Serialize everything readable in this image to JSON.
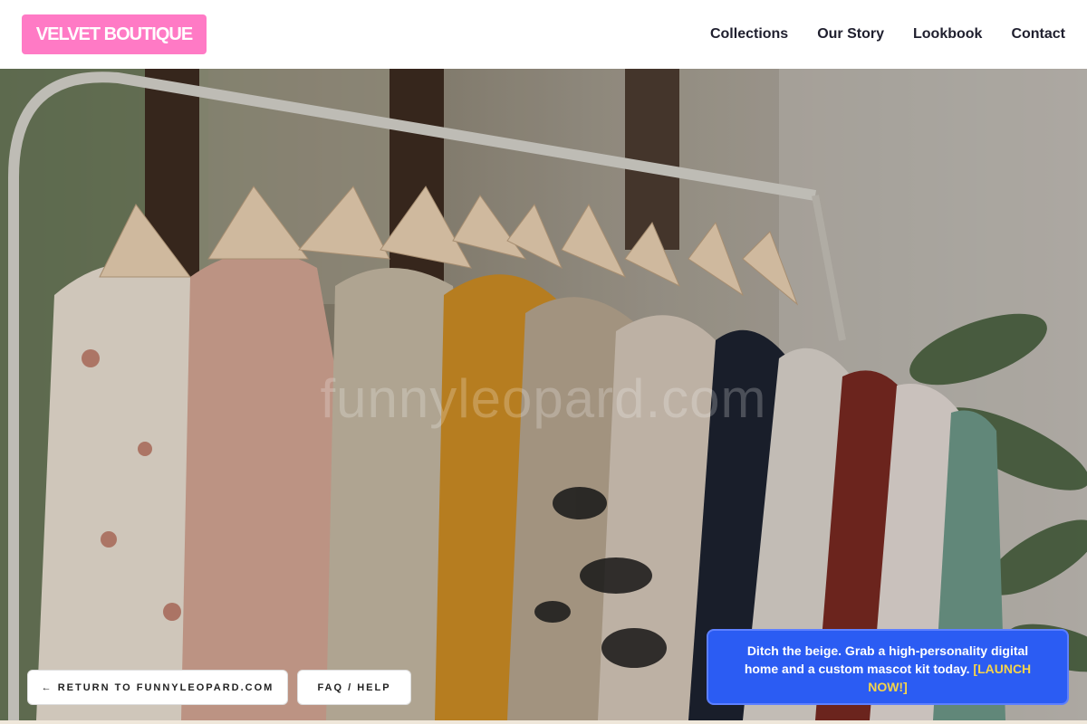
{
  "header": {
    "logo_text": "VELVET BOUTIQUE",
    "logo_bg": "#ff7ac5",
    "nav": [
      {
        "label": "Collections"
      },
      {
        "label": "Our Story"
      },
      {
        "label": "Lookbook"
      },
      {
        "label": "Contact"
      }
    ]
  },
  "hero": {
    "image": "clothing-rack-photo",
    "watermark": "funnyleopard.com"
  },
  "buttons": {
    "return_label": "← RETURN TO FUNNYLEOPARD.COM",
    "faq_label": "FAQ / HELP"
  },
  "promo": {
    "text": "Ditch the beige. Grab a high-personality digital home and a custom mascot kit today.",
    "link_label": "[LAUNCH NOW!]",
    "bg": "#2b5cf3",
    "link_color": "#f5d34b"
  }
}
